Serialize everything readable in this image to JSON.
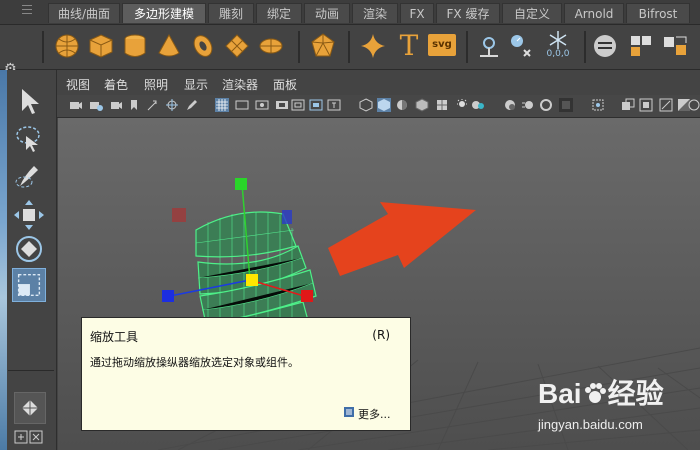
{
  "shelf": {
    "tabs": [
      "曲线/曲面",
      "多边形建模",
      "雕刻",
      "绑定",
      "动画",
      "渲染",
      "FX",
      "FX 缓存",
      "自定义",
      "Arnold",
      "Bifrost"
    ],
    "active_tab": "多边形建模",
    "icons": [
      "sphere-icon",
      "cube-icon",
      "cylinder-icon",
      "cone-icon",
      "torus-icon",
      "plane-icon",
      "disk-icon",
      "platonic-icon",
      "super-shape-icon",
      "text-icon",
      "svg-icon",
      "pivot-icon",
      "type-icon",
      "sweep-icon",
      "combine-icon",
      "extract-icon",
      "separate-icon"
    ],
    "svg_label": "svg",
    "text_label": "T",
    "num_label": "0,0,0"
  },
  "panel": {
    "menu": [
      "视图",
      "着色",
      "照明",
      "显示",
      "渲染器",
      "面板"
    ]
  },
  "tooltip": {
    "title": "缩放工具",
    "shortcut": "(R)",
    "description": "通过拖动缩放操纵器缩放选定对象或组件。",
    "more": "更多..."
  },
  "watermark": {
    "brand_left": "Bai",
    "brand_right": "经验",
    "site": "jingyan.baidu.com"
  },
  "colors": {
    "accent_orange": "#e8a23a",
    "arrow_red": "#e5431d",
    "wire_green": "#3ddf7c",
    "tooltip_bg": "#fdfde5"
  }
}
